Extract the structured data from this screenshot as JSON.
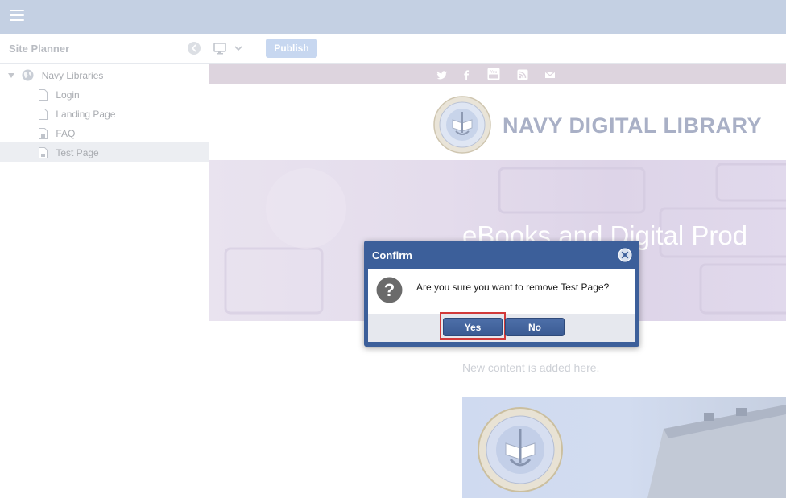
{
  "topbar": {
    "menu_icon": "hamburger-menu-icon"
  },
  "sidebar": {
    "title": "Site Planner",
    "collapse_icon": "chevron-left-circle-icon",
    "tree": {
      "root": {
        "label": "Navy Libraries",
        "icon": "globe-icon",
        "expanded": true
      },
      "pages": [
        {
          "label": "Login",
          "icon": "page-icon",
          "selected": false
        },
        {
          "label": "Landing Page",
          "icon": "page-icon",
          "selected": false
        },
        {
          "label": "FAQ",
          "icon": "page-icon",
          "selected": false
        },
        {
          "label": "Test Page",
          "icon": "page-icon",
          "selected": true
        }
      ]
    }
  },
  "toolbar": {
    "device_icon": "monitor-icon",
    "publish_label": "Publish"
  },
  "canvas": {
    "social_icons": [
      "twitter-icon",
      "facebook-icon",
      "youtube-icon",
      "rss-icon",
      "email-icon"
    ],
    "site_title": "NAVY DIGITAL LIBRARY",
    "hero_text": "eBooks and Digital Prod",
    "content_note": "New content is added here.",
    "colors": {
      "header_bar": "#c4d0e3",
      "social_bar": "#ddd4de",
      "title": "#a9b0c6"
    }
  },
  "dialog": {
    "title": "Confirm",
    "message": "Are you sure you want to remove Test Page?",
    "yes_label": "Yes",
    "no_label": "No",
    "icon": "question-icon",
    "close_icon": "close-circle-icon",
    "colors": {
      "frame": "#3c5f9a",
      "highlight": "#d23a3a"
    }
  }
}
